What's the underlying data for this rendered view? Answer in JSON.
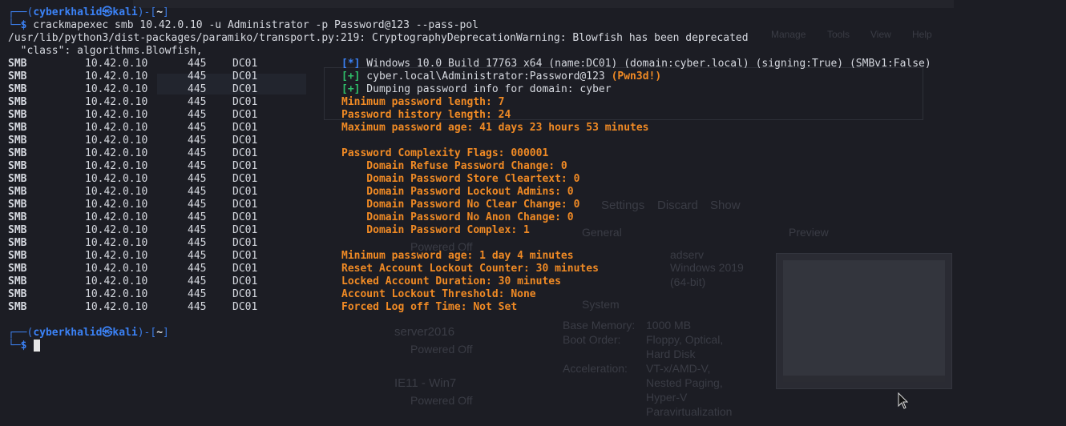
{
  "background": {
    "settings_label": "Settings",
    "discard_label": "Discard",
    "show_label": "Show",
    "general_label": "General",
    "preview_label": "Preview",
    "system_label": "System",
    "name_value": "adserv",
    "os_value": "Windows 2019",
    "os_value2": "(64-bit)",
    "base_memory_label": "Base Memory:",
    "base_memory_value": "1000 MB",
    "boot_order_label": "Boot Order:",
    "boot_order_value1": "Floppy, Optical,",
    "boot_order_value2": "Hard Disk",
    "acceleration_label": "Acceleration:",
    "acceleration_value1": "VT-x/AMD-V,",
    "acceleration_value2": "Nested Paging,",
    "acceleration_value3": "Hyper-V",
    "acceleration_value4": "Paravirtualization",
    "vm1_name": "server2016",
    "vm1_state": "Powered Off",
    "vm2_name": "IE11 - Win7",
    "vm2_state": "Powered Off",
    "vm0_state": "Powered Off",
    "menu_manage": "Manage",
    "menu_tools": "Tools",
    "menu_view": "View",
    "menu_help": "Help"
  },
  "terminal": {
    "prompt1": {
      "open": "┌──(",
      "user": "cyberkhalid㉿kali",
      "close": ")-[",
      "dir": "~",
      "end": "]"
    },
    "prompt_tail": "└─",
    "dollar": "$",
    "command": " crackmapexec smb 10.42.0.10 -u Administrator -p Password@123 --pass-pol",
    "warning_line": "/usr/lib/python3/dist-packages/paramiko/transport.py:219: CryptographyDeprecationWarning: Blowfish has been deprecated",
    "class_line": "  \"class\": algorithms.Blowfish,",
    "rows": [
      {
        "proto": "SMB",
        "ip": "10.42.0.10",
        "port": "445",
        "host": "DC01",
        "tag": "[*]",
        "tag_color": "#3b82f6",
        "msg": " Windows 10.0 Build 17763 x64 (name:DC01) (domain:cyber.local) (signing:True) (SMBv1:False)",
        "msg_color": "#d6d9e0",
        "extra": ""
      },
      {
        "proto": "SMB",
        "ip": "10.42.0.10",
        "port": "445",
        "host": "DC01",
        "tag": "[+]",
        "tag_color": "#2fbf6a",
        "msg": " cyber.local\\Administrator:Password@123 ",
        "msg_color": "#d6d9e0",
        "extra": "(Pwn3d!)"
      },
      {
        "proto": "SMB",
        "ip": "10.42.0.10",
        "port": "445",
        "host": "DC01",
        "tag": "[+]",
        "tag_color": "#2fbf6a",
        "msg": " Dumping password info for domain: cyber",
        "msg_color": "#d6d9e0",
        "extra": ""
      },
      {
        "proto": "SMB",
        "ip": "10.42.0.10",
        "port": "445",
        "host": "DC01",
        "tag": "",
        "msg": "Minimum password length: 7",
        "msg_color": "#f08a24",
        "extra": ""
      },
      {
        "proto": "SMB",
        "ip": "10.42.0.10",
        "port": "445",
        "host": "DC01",
        "tag": "",
        "msg": "Password history length: 24",
        "msg_color": "#f08a24",
        "extra": ""
      },
      {
        "proto": "SMB",
        "ip": "10.42.0.10",
        "port": "445",
        "host": "DC01",
        "tag": "",
        "msg": "Maximum password age: 41 days 23 hours 53 minutes",
        "msg_color": "#f08a24",
        "extra": ""
      },
      {
        "proto": "SMB",
        "ip": "10.42.0.10",
        "port": "445",
        "host": "DC01",
        "tag": "",
        "msg": "",
        "msg_color": "#f08a24",
        "extra": ""
      },
      {
        "proto": "SMB",
        "ip": "10.42.0.10",
        "port": "445",
        "host": "DC01",
        "tag": "",
        "msg": "Password Complexity Flags: 000001",
        "msg_color": "#f08a24",
        "extra": ""
      },
      {
        "proto": "SMB",
        "ip": "10.42.0.10",
        "port": "445",
        "host": "DC01",
        "tag": "",
        "msg": "    Domain Refuse Password Change: 0",
        "msg_color": "#f08a24",
        "extra": ""
      },
      {
        "proto": "SMB",
        "ip": "10.42.0.10",
        "port": "445",
        "host": "DC01",
        "tag": "",
        "msg": "    Domain Password Store Cleartext: 0",
        "msg_color": "#f08a24",
        "extra": ""
      },
      {
        "proto": "SMB",
        "ip": "10.42.0.10",
        "port": "445",
        "host": "DC01",
        "tag": "",
        "msg": "    Domain Password Lockout Admins: 0",
        "msg_color": "#f08a24",
        "extra": ""
      },
      {
        "proto": "SMB",
        "ip": "10.42.0.10",
        "port": "445",
        "host": "DC01",
        "tag": "",
        "msg": "    Domain Password No Clear Change: 0",
        "msg_color": "#f08a24",
        "extra": ""
      },
      {
        "proto": "SMB",
        "ip": "10.42.0.10",
        "port": "445",
        "host": "DC01",
        "tag": "",
        "msg": "    Domain Password No Anon Change: 0",
        "msg_color": "#f08a24",
        "extra": ""
      },
      {
        "proto": "SMB",
        "ip": "10.42.0.10",
        "port": "445",
        "host": "DC01",
        "tag": "",
        "msg": "    Domain Password Complex: 1",
        "msg_color": "#f08a24",
        "extra": ""
      },
      {
        "proto": "SMB",
        "ip": "10.42.0.10",
        "port": "445",
        "host": "DC01",
        "tag": "",
        "msg": "",
        "msg_color": "#f08a24",
        "extra": ""
      },
      {
        "proto": "SMB",
        "ip": "10.42.0.10",
        "port": "445",
        "host": "DC01",
        "tag": "",
        "msg": "Minimum password age: 1 day 4 minutes",
        "msg_color": "#f08a24",
        "extra": ""
      },
      {
        "proto": "SMB",
        "ip": "10.42.0.10",
        "port": "445",
        "host": "DC01",
        "tag": "",
        "msg": "Reset Account Lockout Counter: 30 minutes",
        "msg_color": "#f08a24",
        "extra": ""
      },
      {
        "proto": "SMB",
        "ip": "10.42.0.10",
        "port": "445",
        "host": "DC01",
        "tag": "",
        "msg": "Locked Account Duration: 30 minutes",
        "msg_color": "#f08a24",
        "extra": ""
      },
      {
        "proto": "SMB",
        "ip": "10.42.0.10",
        "port": "445",
        "host": "DC01",
        "tag": "",
        "msg": "Account Lockout Threshold: None",
        "msg_color": "#f08a24",
        "extra": ""
      },
      {
        "proto": "SMB",
        "ip": "10.42.0.10",
        "port": "445",
        "host": "DC01",
        "tag": "",
        "msg": "Forced Log off Time: Not Set",
        "msg_color": "#f08a24",
        "extra": ""
      }
    ],
    "pwned_color": "#f08a24"
  }
}
